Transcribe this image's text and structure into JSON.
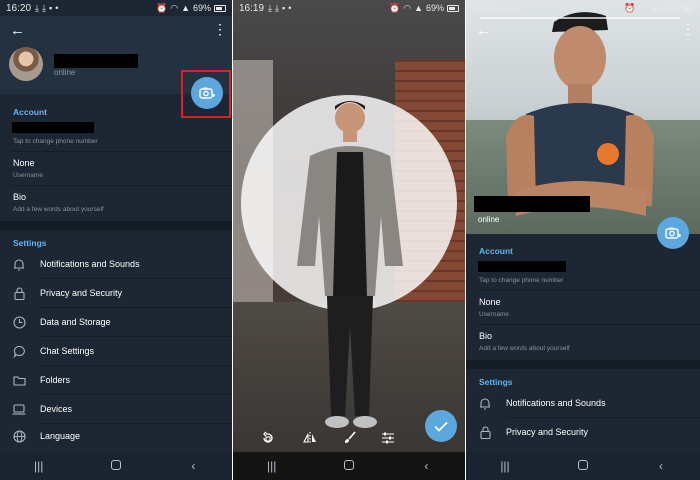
{
  "status_left": {
    "time": "16:20",
    "battery": "69%"
  },
  "status_middle": {
    "time": "16:19",
    "battery": "69%"
  },
  "status_right": {
    "time": "16:20",
    "battery": "69%"
  },
  "profile_left": {
    "online": "online",
    "account_title": "Account",
    "phone_hint": "Tap to change phone number",
    "username_value": "None",
    "username_label": "Username",
    "bio_value": "Bio",
    "bio_hint": "Add a few words about yourself",
    "settings_title": "Settings",
    "settings_items": [
      {
        "label": "Notifications and Sounds",
        "icon": "bell-icon"
      },
      {
        "label": "Privacy and Security",
        "icon": "lock-icon"
      },
      {
        "label": "Data and Storage",
        "icon": "clock-icon"
      },
      {
        "label": "Chat Settings",
        "icon": "chat-bubble-icon"
      },
      {
        "label": "Folders",
        "icon": "folder-icon"
      },
      {
        "label": "Devices",
        "icon": "laptop-icon"
      },
      {
        "label": "Language",
        "icon": "globe-icon"
      }
    ]
  },
  "profile_right": {
    "online": "online",
    "account_title": "Account",
    "phone_hint": "Tap to change phone number",
    "username_value": "None",
    "username_label": "Username",
    "bio_value": "Bio",
    "bio_hint": "Add a few words about yourself",
    "settings_title": "Settings",
    "settings_items": [
      {
        "label": "Notifications and Sounds",
        "icon": "bell-icon"
      },
      {
        "label": "Privacy and Security",
        "icon": "lock-icon"
      }
    ]
  },
  "editor_tools": [
    "rotate-icon",
    "mirror-icon",
    "brush-icon",
    "adjust-icon"
  ],
  "colors": {
    "accent": "#5ca7de",
    "panel_bg": "#1d2733",
    "section_title": "#64b3f0",
    "highlight": "#e02020"
  }
}
